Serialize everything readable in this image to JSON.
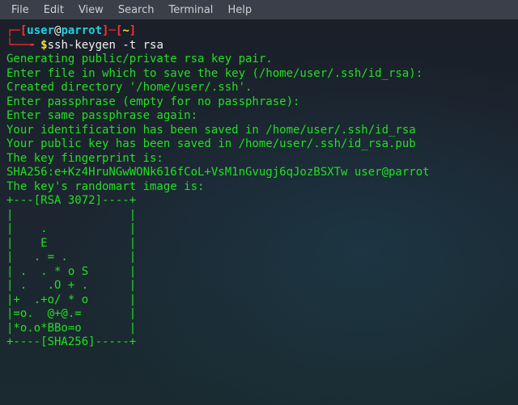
{
  "menubar": {
    "items": [
      "File",
      "Edit",
      "View",
      "Search",
      "Terminal",
      "Help"
    ]
  },
  "prompt": {
    "bracket_open": "┌─[",
    "user": "user",
    "at": "@",
    "host": "parrot",
    "bracket_close": "]─[",
    "cwd": "~",
    "end": "]",
    "line2_prefix": "└──╼ ",
    "dollar": "$",
    "command": "ssh-keygen -t rsa"
  },
  "output": [
    "Generating public/private rsa key pair.",
    "Enter file in which to save the key (/home/user/.ssh/id_rsa):",
    "Created directory '/home/user/.ssh'.",
    "Enter passphrase (empty for no passphrase):",
    "Enter same passphrase again:",
    "Your identification has been saved in /home/user/.ssh/id_rsa",
    "Your public key has been saved in /home/user/.ssh/id_rsa.pub",
    "The key fingerprint is:",
    "SHA256:e+Kz4HruNGwWONk616fCoL+VsM1nGvugj6qJozBSXTw user@parrot",
    "The key's randomart image is:",
    "+---[RSA 3072]----+",
    "|                 |",
    "|    .            |",
    "|    E            |",
    "|   . = .         |",
    "| .  . * o S      |",
    "| .   .O + .      |",
    "|+  .+o/ * o      |",
    "|=o.  @+@.=       |",
    "|*o.o*BBo=o       |",
    "+----[SHA256]-----+"
  ]
}
